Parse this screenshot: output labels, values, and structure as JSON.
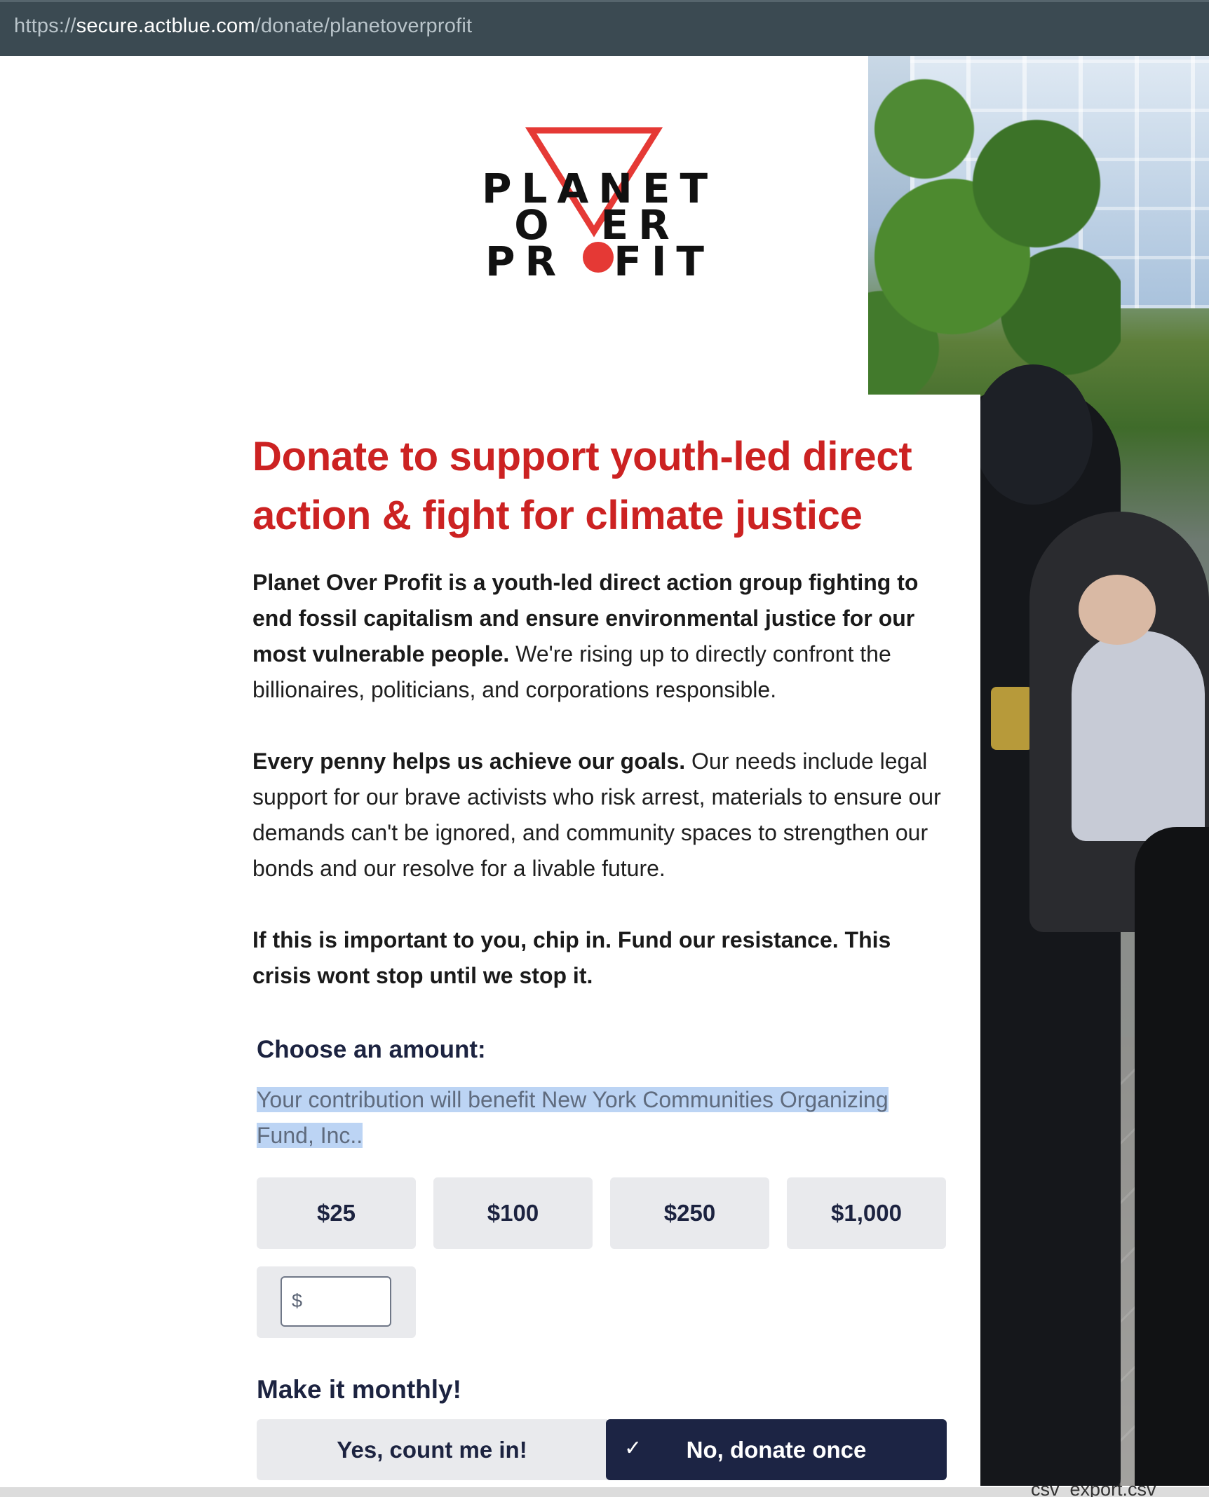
{
  "browser": {
    "url_scheme": "https://",
    "url_host": "secure.actblue.com",
    "url_path": "/donate/planetoverprofit"
  },
  "logo": {
    "line1": "PLANET",
    "line2_a": "O",
    "line2_b": "ER",
    "line3_a": "PR",
    "line3_b": "FIT",
    "accent_color": "#e53935"
  },
  "headline": "Donate to support youth-led direct action & fight for climate justice",
  "paragraphs": {
    "p1_bold": "Planet Over Profit is a youth-led direct action group fighting to end fossil capitalism and ensure environmental justice for our most vulnerable people.",
    "p1_rest": " We're rising up to directly confront the billionaires, politicians, and corporations responsible.",
    "p2_bold": "Every penny helps us achieve our goals.",
    "p2_rest": " Our needs include legal support for our brave activists who risk arrest, materials to ensure our demands can't be ignored, and community spaces to strengthen our bonds and our resolve for a livable future.",
    "p3_bold": "If this is important to you, chip in. Fund our resistance. This crisis wont stop until we stop it."
  },
  "donation": {
    "choose_title": "Choose an amount:",
    "benefit_text": "Your contribution will benefit New York Communities Organizing Fund, Inc..",
    "amounts": [
      "$25",
      "$100",
      "$250",
      "$1,000"
    ],
    "custom_currency": "$",
    "custom_value": ""
  },
  "monthly": {
    "title": "Make it monthly!",
    "yes_label": "Yes, count me in!",
    "no_label": "No, donate once",
    "selected": "no"
  },
  "bottom_bar": {
    "file_label": "csv_export.csv"
  },
  "colors": {
    "headline_red": "#cc2222",
    "navy": "#1c2444",
    "button_gray": "#e9eaed",
    "highlight_blue": "#bcd4f4"
  }
}
